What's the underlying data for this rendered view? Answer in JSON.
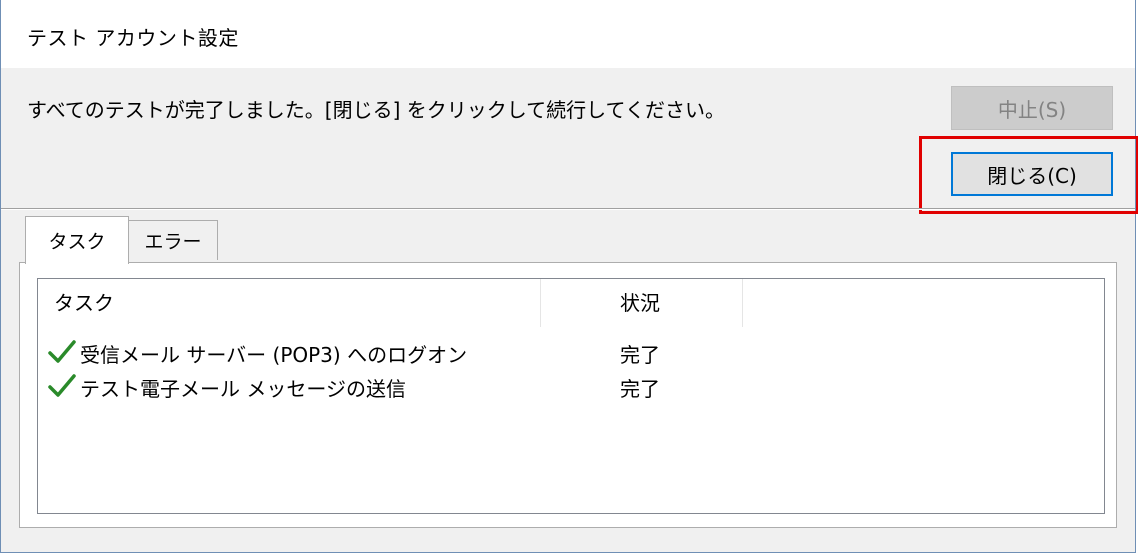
{
  "window": {
    "title": "テスト アカウント設定"
  },
  "message": "すべてのテストが完了しました。[閉じる] をクリックして続行してください。",
  "buttons": {
    "stop_label": "中止(S)",
    "close_label": "閉じる(C)"
  },
  "tabs": [
    {
      "label": "タスク",
      "selected": true
    },
    {
      "label": "エラー",
      "selected": false
    }
  ],
  "table": {
    "columns": [
      "タスク",
      "状況"
    ],
    "rows": [
      {
        "task": "受信メール サーバー (POP3) へのログオン",
        "status": "完了",
        "icon": "checkmark-icon"
      },
      {
        "task": "テスト電子メール メッセージの送信",
        "status": "完了",
        "icon": "checkmark-icon"
      }
    ]
  },
  "colors": {
    "check": "#2a8a2a",
    "highlight": "#e00000",
    "focus_border": "#0078d7"
  }
}
